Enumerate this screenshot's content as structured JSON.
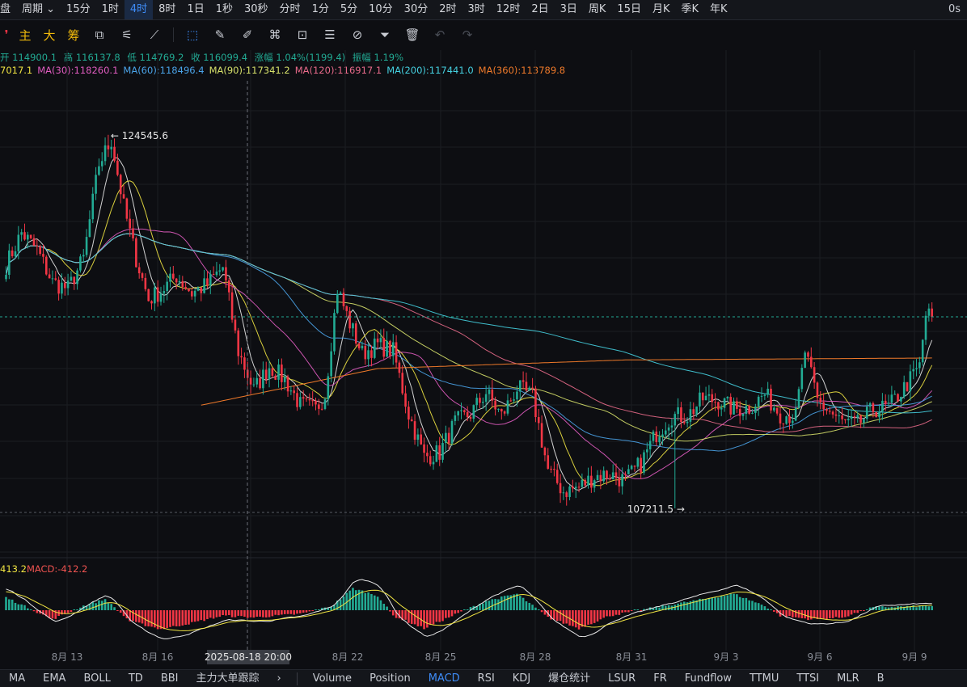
{
  "topbar": {
    "items": [
      "盘",
      "周期",
      "15分",
      "1时",
      "4时",
      "8时",
      "1日",
      "1秒",
      "30秒",
      "分时",
      "1分",
      "5分",
      "10分",
      "30分",
      "2时",
      "3时",
      "12时",
      "2日",
      "3日",
      "周K",
      "15日",
      "月K",
      "季K",
      "年K"
    ],
    "active": "4时",
    "right_text": "0s"
  },
  "toolbar": {
    "main_labels": [
      "主",
      "大",
      "筹"
    ]
  },
  "ohlc": {
    "open": "开 114900.1",
    "high": "高 116137.8",
    "low": "低 114769.2",
    "close": "收 116099.4",
    "change": "涨幅 1.04%(1199.4)",
    "amplitude": "振幅 1.19%"
  },
  "ma_legend": [
    {
      "text": "7017.1",
      "color": "#f0e442"
    },
    {
      "text": "MA(30):118260.1",
      "color": "#e05cc0"
    },
    {
      "text": "MA(60):118496.4",
      "color": "#4aa3e8"
    },
    {
      "text": "MA(90):117341.2",
      "color": "#d6e06a"
    },
    {
      "text": "MA(120):116917.1",
      "color": "#e86a8a"
    },
    {
      "text": "MA(200):117441.0",
      "color": "#45d0e0"
    },
    {
      "text": "MA(360):113789.8",
      "color": "#f07a2a"
    }
  ],
  "macd_legend": [
    {
      "text": "413.2",
      "color": "#f0e442"
    },
    {
      "text": "MACD:-412.2",
      "color": "#ef5350"
    }
  ],
  "annotations": {
    "high_label": "← 124545.6",
    "low_label": "107211.5 →"
  },
  "crosshair_label": "2025-08-18 20:00",
  "bottombar": {
    "left": [
      "MA",
      "EMA",
      "BOLL",
      "TD",
      "BBI",
      "主力大单跟踪"
    ],
    "right": [
      "Volume",
      "Position",
      "MACD",
      "RSI",
      "KDJ",
      "爆仓统计",
      "LSUR",
      "FR",
      "Fundflow",
      "TTMU",
      "TTSI",
      "MLR",
      "B"
    ],
    "active": "MACD"
  },
  "chart_data": {
    "type": "candlestick",
    "interval": "4时",
    "x_tick_labels": [
      "8月 13",
      "8月 16",
      "8月 22",
      "8月 25",
      "8月 28",
      "8月 31",
      "9月 3",
      "9月 6",
      "9月 9"
    ],
    "y_range_approx": [
      105600,
      127200
    ],
    "annotated_high": 124545.6,
    "annotated_low": 107211.5,
    "last_close": 116099.4,
    "moving_averages": {
      "MA30": 118260.1,
      "MA60": 118496.4,
      "MA90": 117341.2,
      "MA120": 116917.1,
      "MA200": 117441.0,
      "MA360": 113789.8
    },
    "price_path_anchors": [
      [
        0,
        118500
      ],
      [
        5,
        120000
      ],
      [
        10,
        119200
      ],
      [
        15,
        117700
      ],
      [
        20,
        117400
      ],
      [
        25,
        118800
      ],
      [
        30,
        123200
      ],
      [
        34,
        124300
      ],
      [
        38,
        121200
      ],
      [
        42,
        118800
      ],
      [
        46,
        116900
      ],
      [
        50,
        117300
      ],
      [
        55,
        118000
      ],
      [
        60,
        117200
      ],
      [
        65,
        117600
      ],
      [
        70,
        118400
      ],
      [
        75,
        114500
      ],
      [
        80,
        112700
      ],
      [
        85,
        113800
      ],
      [
        90,
        113200
      ],
      [
        95,
        112000
      ],
      [
        100,
        111800
      ],
      [
        103,
        112500
      ],
      [
        107,
        117400
      ],
      [
        111,
        115800
      ],
      [
        115,
        114400
      ],
      [
        120,
        114800
      ],
      [
        125,
        114500
      ],
      [
        130,
        111600
      ],
      [
        135,
        109600
      ],
      [
        140,
        109800
      ],
      [
        145,
        111200
      ],
      [
        150,
        111600
      ],
      [
        155,
        112600
      ],
      [
        160,
        111500
      ],
      [
        165,
        112800
      ],
      [
        170,
        112400
      ],
      [
        175,
        109000
      ],
      [
        180,
        108000
      ],
      [
        185,
        108200
      ],
      [
        190,
        108700
      ],
      [
        195,
        108800
      ],
      [
        200,
        108500
      ],
      [
        205,
        109300
      ],
      [
        210,
        110700
      ],
      [
        215,
        111500
      ],
      [
        220,
        111500
      ],
      [
        225,
        112300
      ],
      [
        230,
        112200
      ],
      [
        235,
        111800
      ],
      [
        240,
        111900
      ],
      [
        245,
        112500
      ],
      [
        250,
        111600
      ],
      [
        255,
        111500
      ],
      [
        258,
        114500
      ],
      [
        262,
        112200
      ],
      [
        266,
        111700
      ],
      [
        270,
        111200
      ],
      [
        275,
        111100
      ],
      [
        280,
        111800
      ],
      [
        285,
        111900
      ],
      [
        290,
        112800
      ],
      [
        295,
        113800
      ],
      [
        297,
        116200
      ],
      [
        299,
        116100
      ]
    ],
    "macd_histogram_anchors": [
      [
        0,
        350
      ],
      [
        15,
        -250
      ],
      [
        25,
        120
      ],
      [
        32,
        300
      ],
      [
        40,
        -300
      ],
      [
        50,
        -520
      ],
      [
        60,
        -350
      ],
      [
        70,
        -150
      ],
      [
        80,
        -200
      ],
      [
        95,
        -100
      ],
      [
        105,
        100
      ],
      [
        112,
        600
      ],
      [
        120,
        400
      ],
      [
        125,
        -150
      ],
      [
        135,
        -500
      ],
      [
        145,
        -120
      ],
      [
        155,
        250
      ],
      [
        165,
        450
      ],
      [
        175,
        -200
      ],
      [
        185,
        -500
      ],
      [
        195,
        -150
      ],
      [
        210,
        80
      ],
      [
        225,
        300
      ],
      [
        235,
        450
      ],
      [
        245,
        120
      ],
      [
        250,
        -150
      ],
      [
        260,
        -250
      ],
      [
        270,
        -200
      ],
      [
        280,
        80
      ],
      [
        299,
        120
      ]
    ]
  }
}
